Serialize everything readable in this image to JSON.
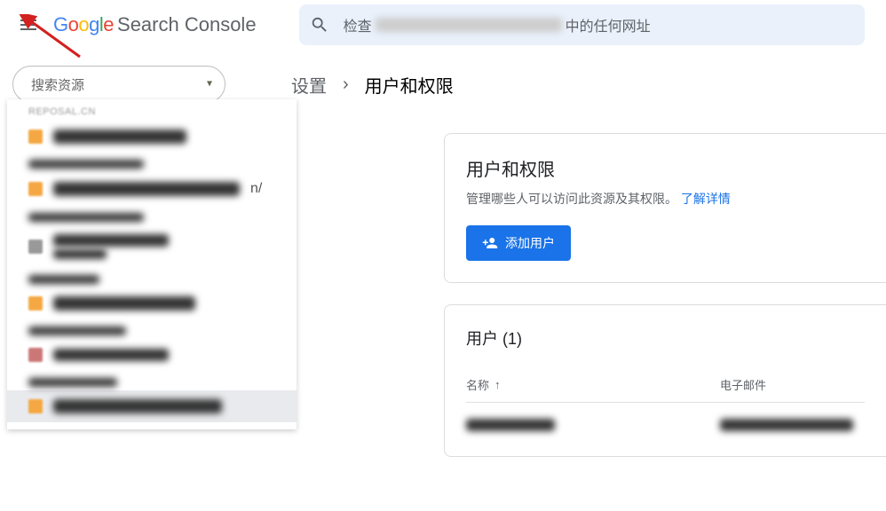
{
  "header": {
    "brand_suffix": "Search Console",
    "url_inspect_prefix": "检查",
    "url_inspect_suffix": "中的任何网址"
  },
  "sidebar": {
    "search_placeholder": "搜索资源"
  },
  "breadcrumb": {
    "parent": "设置",
    "current": "用户和权限"
  },
  "dropdown": {
    "groups": [
      {
        "label": "REPOSAL.CN",
        "items": [
          {}
        ]
      },
      {
        "label": "",
        "items": [
          {}
        ]
      },
      {
        "label": "",
        "items": [
          {
            "two_line": true
          }
        ]
      },
      {
        "label": "",
        "items": [
          {}
        ]
      },
      {
        "label": "",
        "items": [
          {}
        ]
      },
      {
        "label": "",
        "items": [
          {
            "selected": true
          }
        ]
      }
    ]
  },
  "card_permissions": {
    "title": "用户和权限",
    "subtitle": "管理哪些人可以访问此资源及其权限。",
    "learn_more": "了解详情",
    "add_button": "添加用户"
  },
  "card_users": {
    "title": "用户 (1)",
    "col_name": "名称",
    "col_email": "电子邮件"
  }
}
